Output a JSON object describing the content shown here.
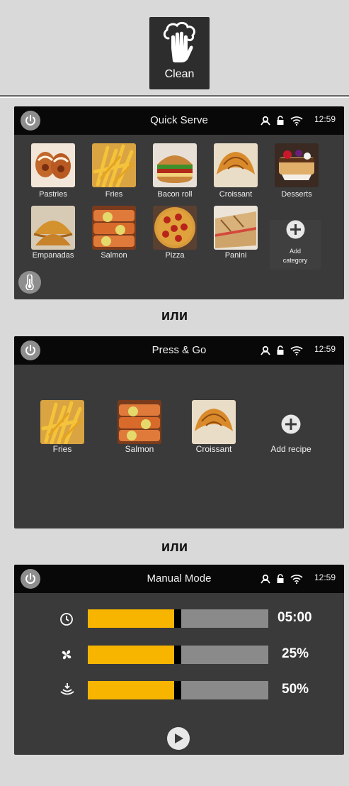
{
  "clean_button": {
    "label": "Clean",
    "icon": "hand-cleaning-icon"
  },
  "status": {
    "time": "12:59",
    "icons": [
      "user-icon",
      "lock-icon",
      "wifi-icon"
    ]
  },
  "separators": [
    "или",
    "или"
  ],
  "quick_serve": {
    "title": "Quick Serve",
    "categories": [
      {
        "label": "Pastries"
      },
      {
        "label": "Fries"
      },
      {
        "label": "Bacon roll"
      },
      {
        "label": "Croissant"
      },
      {
        "label": "Desserts"
      },
      {
        "label": "Empanadas"
      },
      {
        "label": "Salmon"
      },
      {
        "label": "Pizza"
      },
      {
        "label": "Panini"
      }
    ],
    "add_category_line1": "Add",
    "add_category_line2": "category",
    "thermometer_icon": "thermometer-icon"
  },
  "press_go": {
    "title": "Press & Go",
    "recipes": [
      {
        "label": "Fries"
      },
      {
        "label": "Salmon"
      },
      {
        "label": "Croissant"
      }
    ],
    "add_recipe": "Add recipe"
  },
  "manual_mode": {
    "title": "Manual Mode",
    "rows": [
      {
        "icon": "clock-icon",
        "value": "05:00",
        "fill_fraction": 0.48
      },
      {
        "icon": "fan-icon",
        "value": "25%",
        "fill_fraction": 0.48
      },
      {
        "icon": "steam-icon",
        "value": "50%",
        "fill_fraction": 0.48
      }
    ],
    "play_icon": "play-icon"
  },
  "colors": {
    "accent": "#f7b500",
    "screen_bg": "#3a3a3a",
    "header_bg": "#080808"
  }
}
